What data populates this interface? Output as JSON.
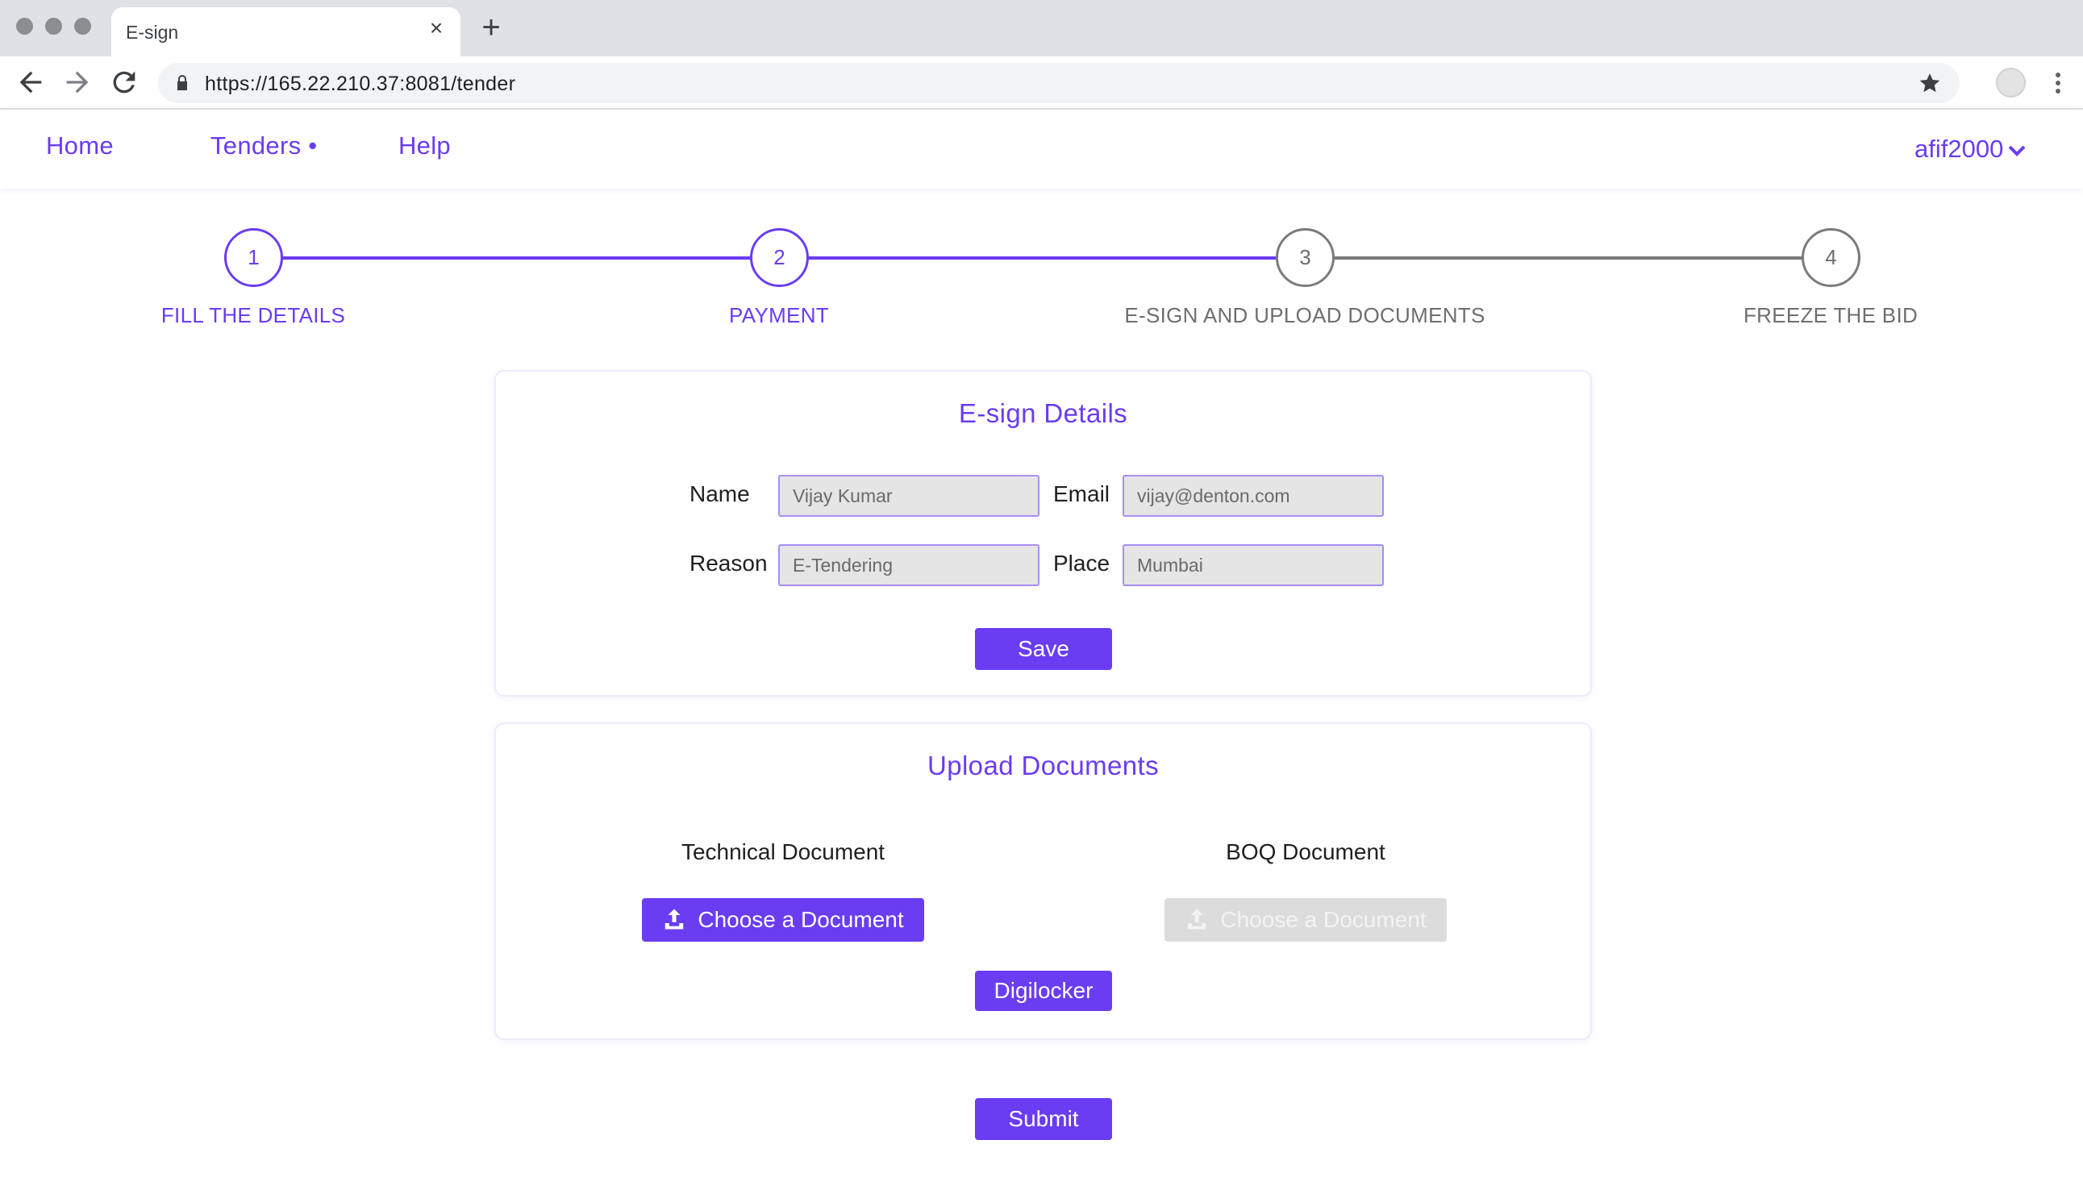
{
  "browser": {
    "tab_title": "E-sign",
    "url": "https://165.22.210.37:8081/tender"
  },
  "nav": {
    "home": "Home",
    "tenders": "Tenders •",
    "help": "Help",
    "user": "afif2000"
  },
  "stepper": {
    "steps": [
      {
        "number": "1",
        "label": "FILL THE DETAILS",
        "state": "done"
      },
      {
        "number": "2",
        "label": "PAYMENT",
        "state": "done"
      },
      {
        "number": "3",
        "label": "E-SIGN AND UPLOAD DOCUMENTS",
        "state": "pending"
      },
      {
        "number": "4",
        "label": "FREEZE THE BID",
        "state": "pending"
      }
    ]
  },
  "esign": {
    "title": "E-sign Details",
    "name_label": "Name",
    "name_value": "Vijay Kumar",
    "email_label": "Email",
    "email_value": "vijay@denton.com",
    "reason_label": "Reason",
    "reason_value": "E-Tendering",
    "place_label": "Place",
    "place_value": "Mumbai",
    "save_label": "Save"
  },
  "upload": {
    "title": "Upload Documents",
    "technical_label": "Technical Document",
    "technical_button": "Choose a Document",
    "boq_label": "BOQ Document",
    "boq_button": "Choose a Document",
    "boq_disabled": true,
    "digilocker_label": "Digilocker"
  },
  "submit_label": "Submit",
  "colors": {
    "accent": "#6a3cf2",
    "disabled": "#dcdcdc"
  }
}
